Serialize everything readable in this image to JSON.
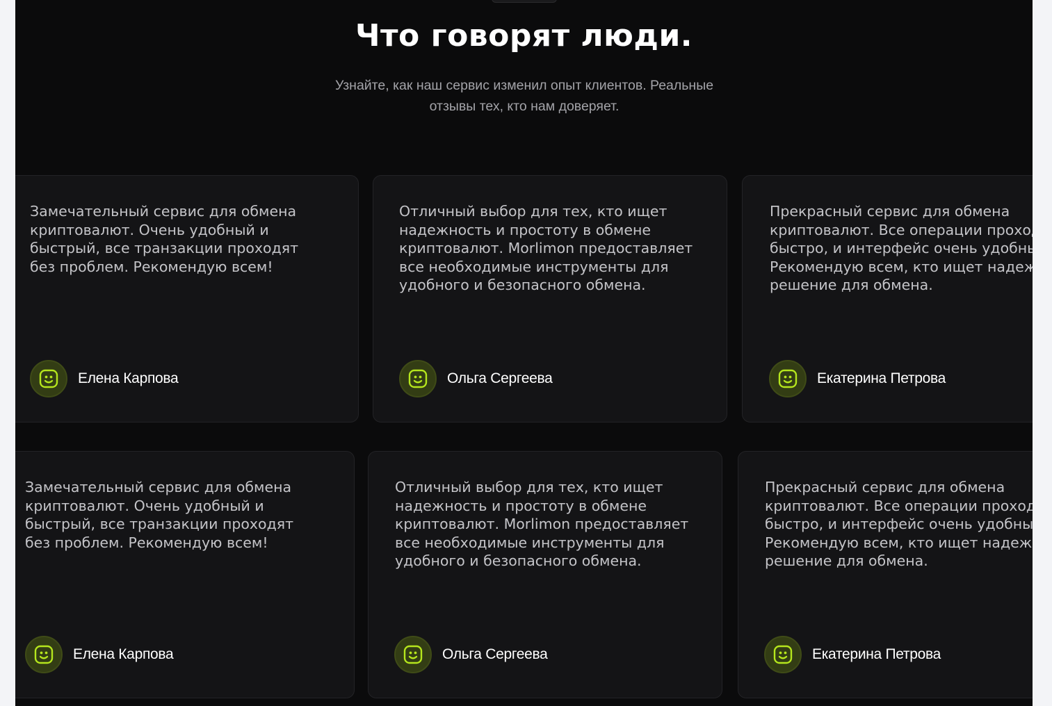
{
  "section": {
    "title": "Что говорят люди.",
    "subtitle": "Узнайте, как наш сервис изменил опыт клиентов. Реальные отзывы тех, кто нам доверяет."
  },
  "colors": {
    "background": "#0b0b0c",
    "card": "#141416",
    "accent": "#b5e61d",
    "avatar_bg": "#333d14"
  },
  "rows": [
    {
      "cards": [
        {
          "text": "Замечательный сервис для обмена\nкриптовалют. Очень удобный и\nбыстрый, все транзакции проходят\nбез проблем. Рекомендую всем!",
          "author": "Елена Карпова",
          "avatar_icon": "smiley-face-icon"
        },
        {
          "text": "Отличный выбор для тех, кто ищет\nнадежность и простоту в обмене\nкриптовалют. Morlimon предоставляет\nвсе необходимые инструменты для\nудобного и безопасного обмена.",
          "author": "Ольга Сергеева",
          "avatar_icon": "smiley-face-icon"
        },
        {
          "text": "Прекрасный сервис для обмена\nкриптовалют. Все операции проходят\nбыстро, и интерфейс очень удобный.\nРекомендую всем, кто ищет надежное\nрешение для обмена.",
          "author": "Екатерина Петрова",
          "avatar_icon": "smiley-face-icon"
        }
      ]
    },
    {
      "cards": [
        {
          "text": "Замечательный сервис для обмена\nкриптовалют. Очень удобный и\nбыстрый, все транзакции проходят\nбез проблем. Рекомендую всем!",
          "author": "Елена Карпова",
          "avatar_icon": "smiley-face-icon"
        },
        {
          "text": "Отличный выбор для тех, кто ищет\nнадежность и простоту в обмене\nкриптовалют. Morlimon предоставляет\nвсе необходимые инструменты для\nудобного и безопасного обмена.",
          "author": "Ольга Сергеева",
          "avatar_icon": "smiley-face-icon"
        },
        {
          "text": "Прекрасный сервис для обмена\nкриптовалют. Все операции проходят\nбыстро, и интерфейс очень удобный.\nРекомендую всем, кто ищет надежное\nрешение для обмена.",
          "author": "Екатерина Петрова",
          "avatar_icon": "smiley-face-icon"
        }
      ]
    }
  ]
}
